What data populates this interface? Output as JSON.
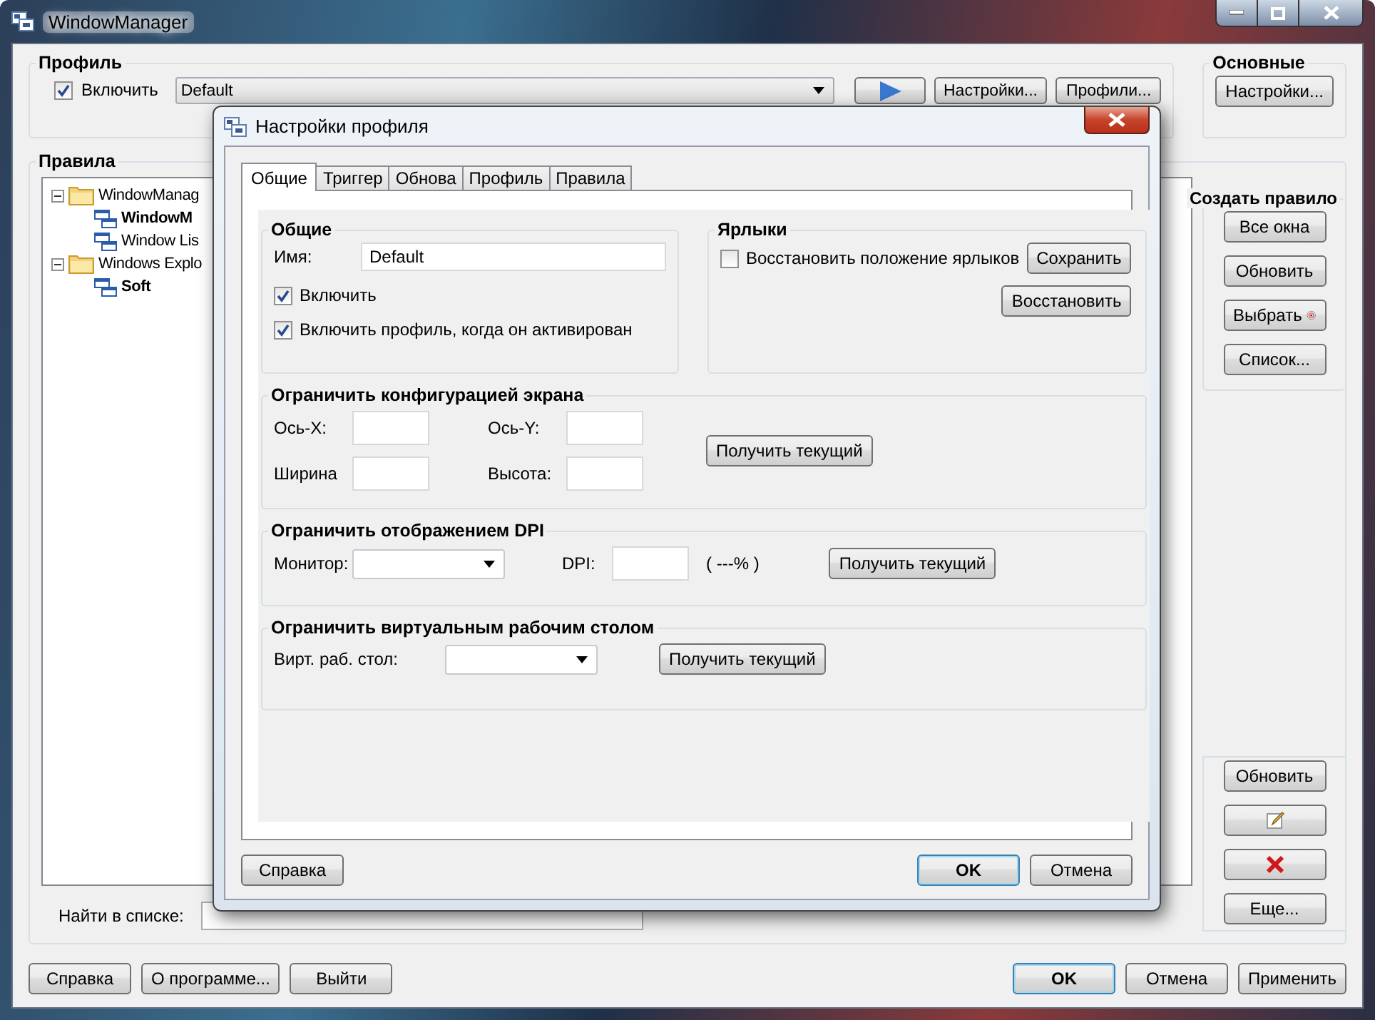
{
  "main_window": {
    "title": "WindowManager"
  },
  "profile": {
    "title": "Профиль",
    "enable": {
      "label": "Включить",
      "checked": true
    },
    "select": {
      "value": "Default"
    },
    "buttons": [
      "Настройки...",
      "Профили..."
    ]
  },
  "general": {
    "title": "Основные",
    "button": "Настройки..."
  },
  "rules": {
    "title": "Правила",
    "tree": [
      {
        "label": "WindowManag",
        "expanded": true,
        "children": [
          {
            "label": "WindowM",
            "bold": true
          },
          {
            "label": "Window Lis",
            "bold": false
          }
        ]
      },
      {
        "label": "Windows Explo",
        "expanded": true,
        "children": [
          {
            "label": "Soft",
            "bold": true
          }
        ]
      }
    ],
    "search_label": "Найти в списке:"
  },
  "create_rule": {
    "title": "Создать правило",
    "buttons": [
      {
        "kind": "text",
        "label": "Все окна"
      },
      {
        "kind": "text",
        "label": "Обновить"
      },
      {
        "kind": "target",
        "label": "Выбрать"
      },
      {
        "kind": "text",
        "label": "Список..."
      }
    ]
  },
  "rule_actions": [
    {
      "kind": "text",
      "label": "Обновить"
    },
    {
      "kind": "edit"
    },
    {
      "kind": "delete"
    },
    {
      "kind": "text",
      "label": "Еще..."
    }
  ],
  "bottom_left": [
    {
      "label": "Справка",
      "default": false
    },
    {
      "label": "О программе...",
      "default": false
    },
    {
      "label": "Выйти",
      "default": false
    }
  ],
  "bottom_right": [
    {
      "label": "OK",
      "default": true
    },
    {
      "label": "Отмена",
      "default": false
    },
    {
      "label": "Применить",
      "default": false
    }
  ],
  "dialog": {
    "title": "Настройки профиля",
    "tabs": [
      {
        "label": "Общие",
        "selected": true
      },
      {
        "label": "Триггер",
        "selected": false
      },
      {
        "label": "Обнова",
        "selected": false
      },
      {
        "label": "Профиль",
        "selected": false
      },
      {
        "label": "Правила",
        "selected": false
      }
    ],
    "general": {
      "title": "Общие",
      "name_label": "Имя:",
      "name_value": "Default",
      "checks": [
        {
          "label": "Включить",
          "checked": true
        },
        {
          "label": "Включить профиль, когда он активирован",
          "checked": true
        }
      ]
    },
    "shortcuts": {
      "title": "Ярлыки",
      "restore": {
        "label": "Восстановить положение ярлыков",
        "checked": false
      },
      "save_button": "Сохранить",
      "restore_button": "Восстановить"
    },
    "screen": {
      "title": "Ограничить конфигурацией экрана",
      "fields": [
        "Ось-X:",
        "Ось-Y:",
        "Ширина",
        "Высота:"
      ],
      "button": "Получить текущий"
    },
    "dpi": {
      "title": "Ограничить отображением DPI",
      "monitor_label": "Монитор:",
      "dpi_label": "DPI:",
      "percent": "( ---% )",
      "button": "Получить текущий"
    },
    "desktop": {
      "title": "Ограничить виртуальным рабочим столом",
      "label": "Вирт. раб. стол:",
      "button": "Получить текущий"
    },
    "buttons": [
      {
        "label": "Справка",
        "default": false
      },
      {
        "label": "OK",
        "default": true
      },
      {
        "label": "Отмена",
        "default": false
      }
    ]
  }
}
